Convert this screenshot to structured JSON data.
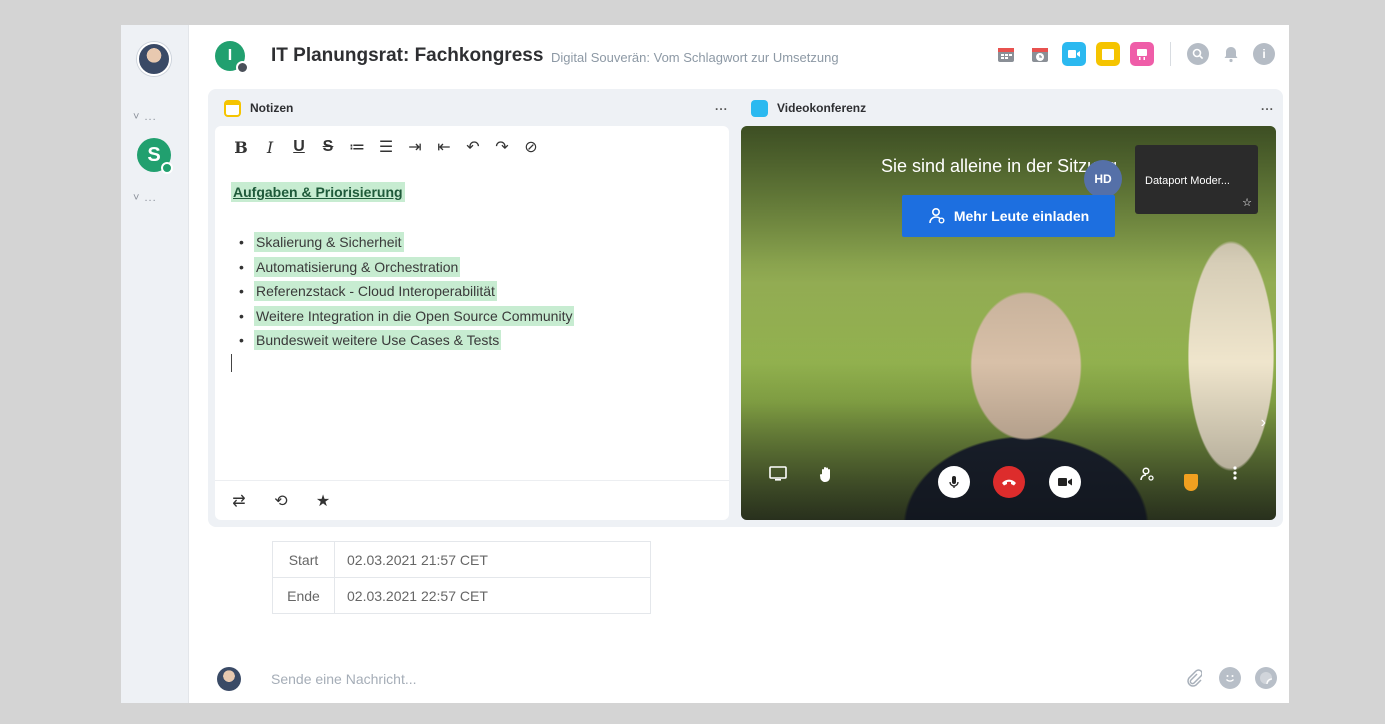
{
  "rail": {
    "collapse_1": "˅ ...",
    "collapse_2": "˅ ...",
    "space_letter": "S"
  },
  "header": {
    "room_letter": "I",
    "title": "IT Planungsrat: Fachkongress",
    "topic": "Digital Souverän: Vom Schlagwort zur Umsetzung",
    "info_glyph": "i",
    "colors": {
      "calendar": "#e8524f",
      "video": "#2bb9f0",
      "notes": "#f5c400",
      "whiteboard": "#ef5da8"
    }
  },
  "widgets": {
    "notes": {
      "title": "Notizen",
      "menu": "...",
      "toolbar": [
        "B",
        "I",
        "U",
        "S",
        "≔",
        "☰",
        "⇥",
        "⇤",
        "↶",
        "↷",
        "⊘"
      ],
      "heading": "Aufgaben & Priorisierung",
      "items": [
        "Skalierung & Sicherheit",
        "Automatisierung & Orchestration",
        "Referenzstack - Cloud Interoperabilität",
        "Weitere Integration in die Open Source Community",
        "Bundesweit weitere Use Cases & Tests"
      ],
      "footer_icons": [
        "⇄",
        "⟲",
        "★"
      ]
    },
    "video": {
      "title": "Videokonferenz",
      "menu": "...",
      "alone_text": "Sie sind alleine in der Sitzung",
      "invite_label": "Mehr Leute einladen",
      "hd_label": "HD",
      "thumb_name": "Dataport Moder...",
      "thumb_star": "☆",
      "next_glyph": "›"
    }
  },
  "times": {
    "start_label": "Start",
    "start_value": "02.03.2021 21:57 CET",
    "end_label": "Ende",
    "end_value": "02.03.2021 22:57 CET"
  },
  "composer": {
    "placeholder": "Sende eine Nachricht..."
  }
}
